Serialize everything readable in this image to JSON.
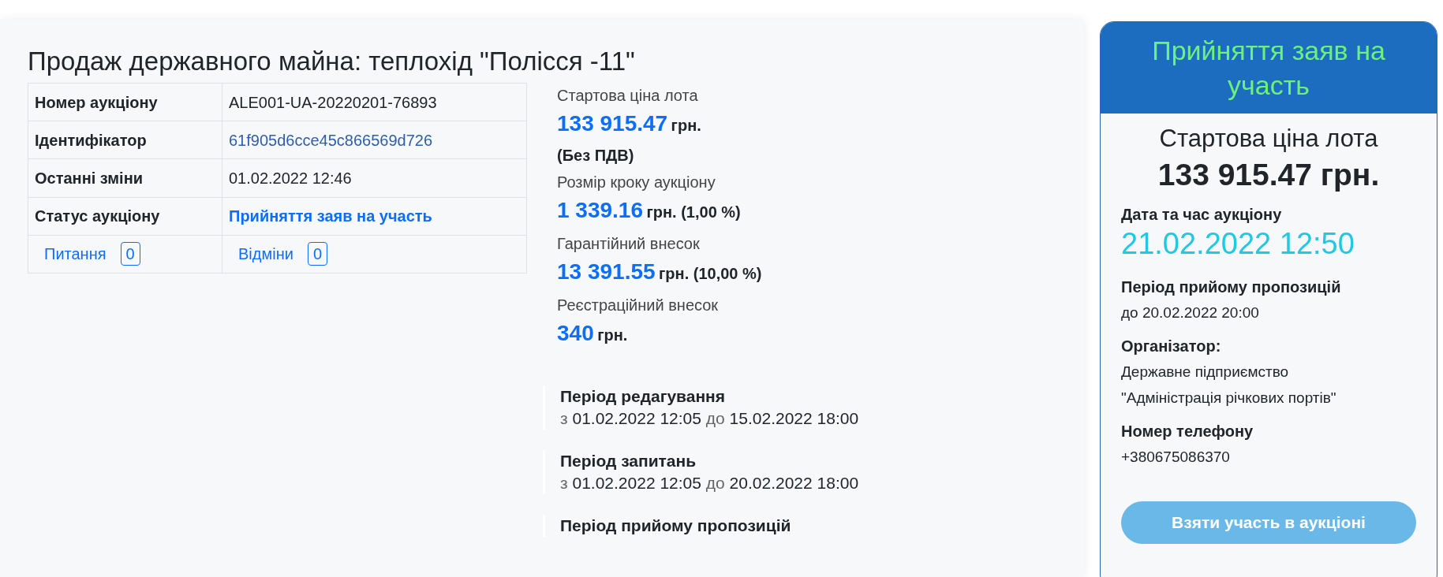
{
  "title": "Продаж державного майна: теплохід \"Полісся -11\"",
  "details": [
    {
      "label": "Номер аукціону",
      "value": "ALE001-UA-20220201-76893",
      "kind": "text"
    },
    {
      "label": "Ідентифікатор",
      "value": "61f905d6cce45c866569d726",
      "kind": "link"
    },
    {
      "label": "Останні зміни",
      "value": "01.02.2022 12:46",
      "kind": "text"
    },
    {
      "label": "Статус аукціону",
      "value": "Прийняття заяв на участь",
      "kind": "status"
    }
  ],
  "counters": [
    {
      "label": "Питання",
      "count": "0"
    },
    {
      "label": "Відміни",
      "count": "0"
    }
  ],
  "prices": [
    {
      "label": "Стартова ціна лота",
      "amount": "133 915.47",
      "unit": "грн.",
      "note": "(Без ПДВ)"
    },
    {
      "label": "Розмір кроку аукціону",
      "amount": "1 339.16",
      "unit": "грн. (1,00 %)"
    },
    {
      "label": "Гарантійний внесок",
      "amount": "13 391.55",
      "unit": "грн. (10,00 %)"
    },
    {
      "label": "Реєстраційний внесок",
      "amount": "340",
      "unit": "грн."
    }
  ],
  "periods": [
    {
      "title": "Період редагування",
      "from_word": "з",
      "from": "01.02.2022 12:05",
      "to_word": "до",
      "to": "15.02.2022 18:00"
    },
    {
      "title": "Період запитань",
      "from_word": "з",
      "from": "01.02.2022 12:05",
      "to_word": "до",
      "to": "20.02.2022 18:00"
    },
    {
      "title": "Період прийому пропозицій"
    }
  ],
  "card": {
    "status": "Прийняття заяв на участь",
    "price_label": "Стартова ціна лота",
    "price": "133 915.47 грн.",
    "date_label": "Дата та час аукціону",
    "date": "21.02.2022 12:50",
    "fields": [
      {
        "label": "Період прийому пропозицій",
        "lines": [
          "до 20.02.2022 20:00"
        ]
      },
      {
        "label": "Організатор:",
        "lines": [
          "Державне підприємство",
          "\"Адміністрація річкових портів\""
        ]
      },
      {
        "label": "Номер телефону",
        "lines": [
          "+380675086370"
        ]
      }
    ],
    "button": "Взяти участь в аукціоні"
  }
}
